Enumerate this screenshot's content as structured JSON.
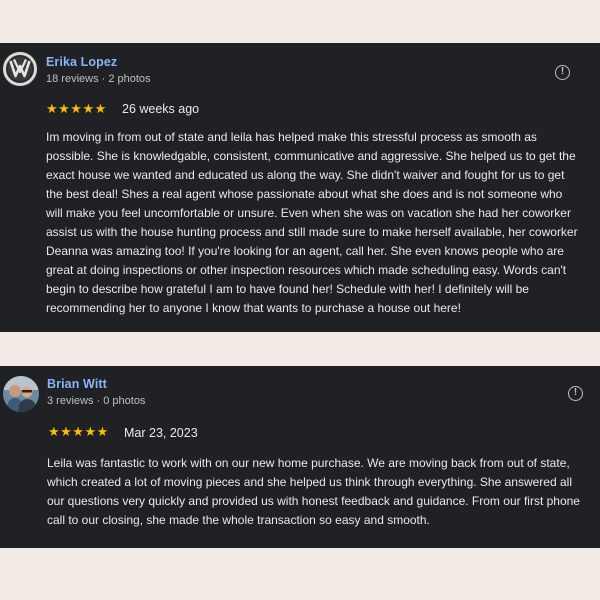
{
  "reviews": [
    {
      "author": "Erika Lopez",
      "meta": "18 reviews · 2 photos",
      "avatar_icon": "car-brand-logo",
      "stars": "★★★★★",
      "rating": 5,
      "when": "26 weeks ago",
      "text": "Im moving in from out of state and leila has helped make this stressful process as smooth as possible. She is knowledgable, consistent, communicative and aggressive. She helped us to get the exact house we wanted and educated us along the way. She didn't waiver and fought for us to get the best deal! Shes a real agent whose passionate about what she does and is not someone who will make you feel uncomfortable or unsure. Even when she was on vacation she had her coworker assist us with the house hunting process and still made sure to make herself available, her coworker Deanna was amazing too! If you're looking for an agent, call her. She even knows people who are great at doing inspections or other inspection resources which made scheduling easy. Words can't begin to describe how grateful I am to have found her! Schedule with her! I definitely will be recommending her to anyone I know that wants to purchase a house out here!"
    },
    {
      "author": "Brian Witt",
      "meta": "3 reviews · 0 photos",
      "avatar_icon": "profile-photo",
      "stars": "★★★★★",
      "rating": 5,
      "when": "Mar 23, 2023",
      "text": "Leila was fantastic to work with on our new home purchase. We are moving back from out of state, which created a lot of moving pieces and she helped us think through everything. She answered all our questions very quickly and provided us with honest feedback and guidance. From our first phone call to our closing, she made the whole transaction so easy and smooth."
    }
  ],
  "flag_icon": "report-flag-icon",
  "colors": {
    "page_bg": "#f2ebe5",
    "card_bg": "#202124",
    "name": "#8ab4f8",
    "star": "#fbbc04",
    "text": "#e8eaed",
    "meta": "#bdc1c6"
  }
}
